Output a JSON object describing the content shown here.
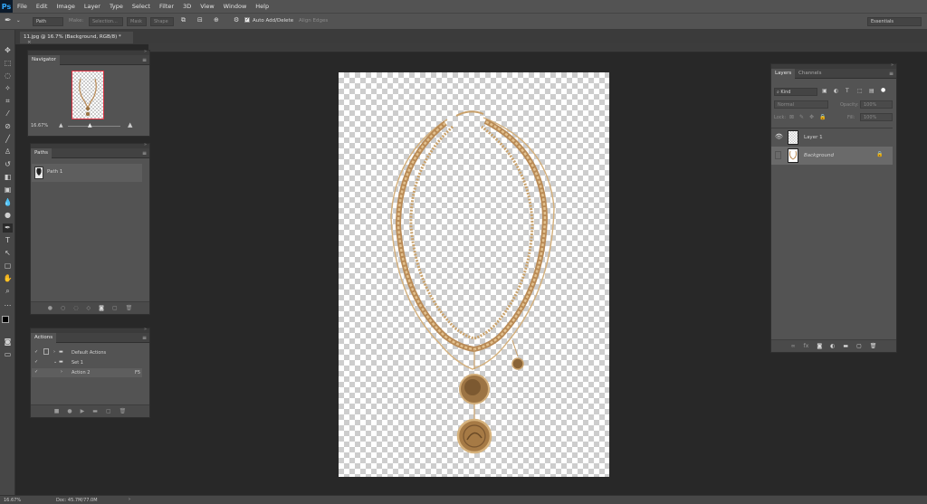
{
  "app": {
    "logo": "Ps"
  },
  "menu": [
    "File",
    "Edit",
    "Image",
    "Layer",
    "Type",
    "Select",
    "Filter",
    "3D",
    "View",
    "Window",
    "Help"
  ],
  "options": {
    "tool_mode": "Path",
    "make_label": "Make:",
    "selection": "Selection...",
    "mask": "Mask",
    "shape": "Shape",
    "auto_add_delete": "Auto Add/Delete",
    "align_edges": "Align Edges",
    "workspace": "Essentials"
  },
  "document": {
    "tab_title": "11.jpg @ 16.7% (Background, RGB/8) *"
  },
  "navigator": {
    "title": "Navigator",
    "zoom": "16.67%"
  },
  "paths": {
    "title": "Paths",
    "items": [
      {
        "name": "Path 1"
      }
    ]
  },
  "actions": {
    "title": "Actions",
    "rows": [
      {
        "label": "Default Actions",
        "shortcut": ""
      },
      {
        "label": "Set 1",
        "shortcut": ""
      },
      {
        "label": "Action 2",
        "shortcut": "F5"
      }
    ]
  },
  "layers": {
    "tabs": [
      "Layers",
      "Channels"
    ],
    "filter_kind": "Kind",
    "blend_mode": "Normal",
    "opacity_label": "Opacity:",
    "opacity_value": "100%",
    "lock_label": "Lock:",
    "fill_label": "Fill:",
    "fill_value": "100%",
    "items": [
      {
        "name": "Layer 1"
      },
      {
        "name": "Background"
      }
    ]
  },
  "status": {
    "zoom": "16.67%",
    "doc": "Doc: 45.7M/77.0M"
  },
  "colors": {
    "gold": "#c8a06a",
    "gold_dark": "#8a6437",
    "selection": "#6a6a6a"
  }
}
